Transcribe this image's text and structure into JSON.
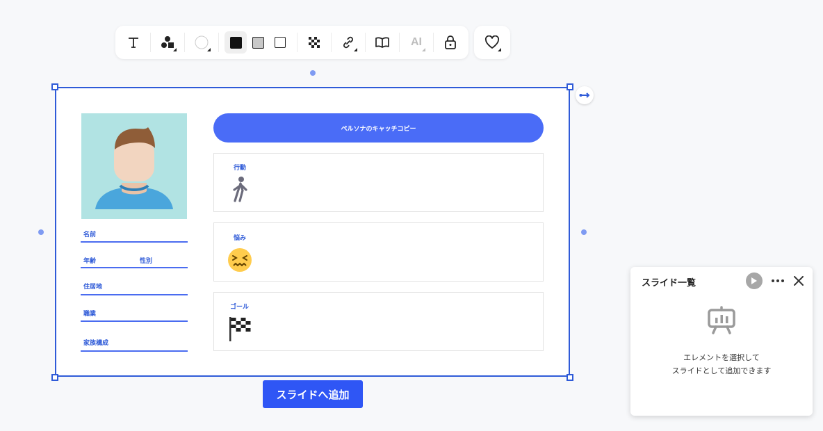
{
  "toolbar": {
    "tools": [
      {
        "name": "text-tool",
        "icon": "text-icon"
      },
      {
        "name": "shapes-tool",
        "icon": "shapes-icon"
      },
      {
        "name": "color-tool",
        "icon": "color-circle-icon"
      },
      {
        "name": "fill-black-tool",
        "icon": "square-filled-black-icon"
      },
      {
        "name": "fill-gray-tool",
        "icon": "square-filled-gray-icon"
      },
      {
        "name": "fill-none-tool",
        "icon": "square-outline-icon"
      },
      {
        "name": "transparency-tool",
        "icon": "checker-icon"
      },
      {
        "name": "link-tool",
        "icon": "link-icon"
      },
      {
        "name": "library-tool",
        "icon": "book-icon"
      },
      {
        "name": "ai-tool",
        "icon": "ai-icon",
        "label": "AI"
      },
      {
        "name": "lock-tool",
        "icon": "lock-icon"
      }
    ],
    "favorite_icon": "heart-icon"
  },
  "slide": {
    "catchcopy": "ペルソナのキャッチコピー",
    "fields": {
      "name": "名前",
      "age": "年齢",
      "gender": "性別",
      "residence": "住居地",
      "occupation": "職業",
      "family": "家族構成"
    },
    "sections": [
      {
        "title": "行動",
        "icon": "walking-person-icon"
      },
      {
        "title": "悩み",
        "icon": "confounded-face-icon"
      },
      {
        "title": "ゴール",
        "icon": "checkered-flag-icon"
      }
    ]
  },
  "add_button": "スライドへ追加",
  "panel": {
    "title": "スライド一覧",
    "message_line1": "エレメントを選択して",
    "message_line2": "スライドとして追加できます"
  },
  "colors": {
    "accent": "#2f5bd8",
    "button": "#2f56f5",
    "catch_bg": "#4a6cf7",
    "photo_bg": "#b1e3e3"
  }
}
